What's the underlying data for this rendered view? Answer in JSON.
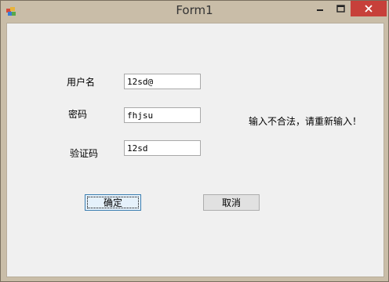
{
  "window": {
    "title": "Form1",
    "icons": {
      "app": "app-icon",
      "minimize": "minimize-icon",
      "maximize": "maximize-icon",
      "close": "close-icon"
    }
  },
  "form": {
    "username_label": "用户名",
    "username_value": "12sd@",
    "password_label": "密码",
    "password_value": "fhjsu",
    "captcha_label": "验证码",
    "captcha_value": "12sd",
    "error_message": "输入不合法，请重新输入！",
    "ok_label": "确定",
    "cancel_label": "取消"
  },
  "colors": {
    "titlebar": "#c9bda8",
    "close_button": "#c7403a",
    "client_bg": "#f0f0f0"
  }
}
